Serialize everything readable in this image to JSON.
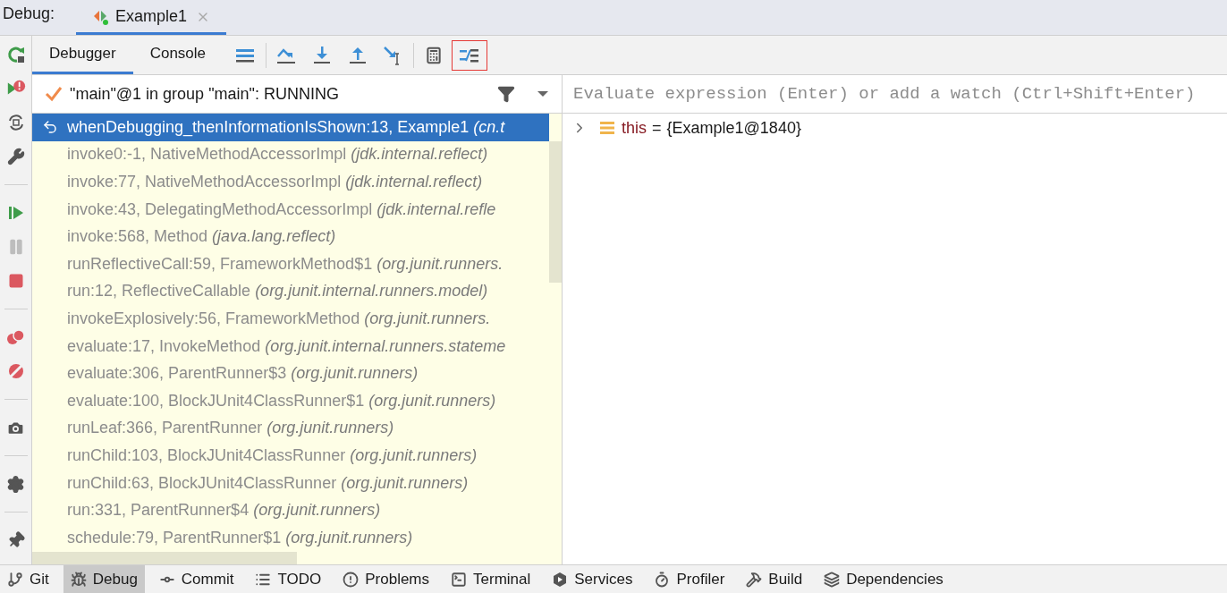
{
  "debug_label": "Debug:",
  "session_tabs": [
    {
      "label": "Example1",
      "selected": true
    }
  ],
  "tabs": [
    {
      "label": "Debugger",
      "selected": true
    },
    {
      "label": "Console",
      "selected": false
    }
  ],
  "thread": {
    "label": "\"main\"@1 in group \"main\": RUNNING"
  },
  "frames": [
    {
      "method": "whenDebugging_thenInformationIsShown:13, Example1",
      "package": "(cn.t",
      "selected": true
    },
    {
      "method": "invoke0:-1, NativeMethodAccessorImpl",
      "package": "(jdk.internal.reflect)",
      "selected": false
    },
    {
      "method": "invoke:77, NativeMethodAccessorImpl",
      "package": "(jdk.internal.reflect)",
      "selected": false
    },
    {
      "method": "invoke:43, DelegatingMethodAccessorImpl",
      "package": "(jdk.internal.refle",
      "selected": false
    },
    {
      "method": "invoke:568, Method",
      "package": "(java.lang.reflect)",
      "selected": false
    },
    {
      "method": "runReflectiveCall:59, FrameworkMethod$1",
      "package": "(org.junit.runners.",
      "selected": false
    },
    {
      "method": "run:12, ReflectiveCallable",
      "package": "(org.junit.internal.runners.model)",
      "selected": false
    },
    {
      "method": "invokeExplosively:56, FrameworkMethod",
      "package": "(org.junit.runners.",
      "selected": false
    },
    {
      "method": "evaluate:17, InvokeMethod",
      "package": "(org.junit.internal.runners.stateme",
      "selected": false
    },
    {
      "method": "evaluate:306, ParentRunner$3",
      "package": "(org.junit.runners)",
      "selected": false
    },
    {
      "method": "evaluate:100, BlockJUnit4ClassRunner$1",
      "package": "(org.junit.runners)",
      "selected": false
    },
    {
      "method": "runLeaf:366, ParentRunner",
      "package": "(org.junit.runners)",
      "selected": false
    },
    {
      "method": "runChild:103, BlockJUnit4ClassRunner",
      "package": "(org.junit.runners)",
      "selected": false
    },
    {
      "method": "runChild:63, BlockJUnit4ClassRunner",
      "package": "(org.junit.runners)",
      "selected": false
    },
    {
      "method": "run:331, ParentRunner$4",
      "package": "(org.junit.runners)",
      "selected": false
    },
    {
      "method": "schedule:79, ParentRunner$1",
      "package": "(org.junit.runners)",
      "selected": false
    }
  ],
  "watch": {
    "placeholder": "Evaluate expression (Enter) or add a watch (Ctrl+Shift+Enter)"
  },
  "variables": [
    {
      "name": "this",
      "operator": "=",
      "value": "{Example1@1840}",
      "expanded": false
    }
  ],
  "status_bar": [
    {
      "kind": "git",
      "label": "Git",
      "selected": false
    },
    {
      "kind": "debug",
      "label": "Debug",
      "selected": true
    },
    {
      "kind": "commit",
      "label": "Commit",
      "selected": false
    },
    {
      "kind": "todo",
      "label": "TODO",
      "selected": false
    },
    {
      "kind": "problems",
      "label": "Problems",
      "selected": false
    },
    {
      "kind": "terminal",
      "label": "Terminal",
      "selected": false
    },
    {
      "kind": "services",
      "label": "Services",
      "selected": false
    },
    {
      "kind": "profiler",
      "label": "Profiler",
      "selected": false
    },
    {
      "kind": "build",
      "label": "Build",
      "selected": false
    },
    {
      "kind": "dependencies",
      "label": "Dependencies",
      "selected": false
    }
  ]
}
